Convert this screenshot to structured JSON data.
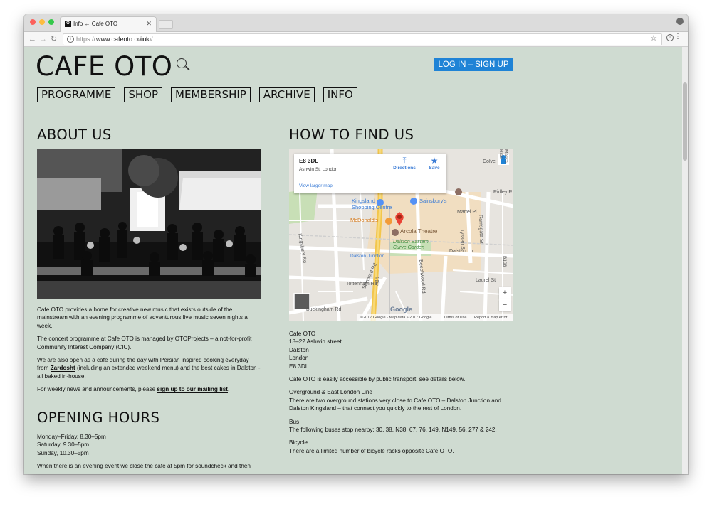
{
  "browser": {
    "tab_title": "Info ← Cafe OTO",
    "url_prefix": "https://",
    "url_host": "www.cafeoto.co.uk",
    "url_path": "/info/"
  },
  "site": {
    "logo": "CAFE OTO",
    "login_label": "LOG IN – SIGN UP",
    "nav": [
      "PROGRAMME",
      "SHOP",
      "MEMBERSHIP",
      "ARCHIVE",
      "INFO"
    ]
  },
  "about": {
    "heading": "ABOUT US",
    "p1": "Cafe OTO provides a home for creative new music that exists outside of the mainstream with an evening programme of adventurous live music seven nights a week.",
    "p2": "The concert programme at Cafe OTO is managed by OTOProjects – a not-for-profit Community Interest Company (CIC).",
    "p3_a": "We are also open as a cafe during the day with Persian inspired cooking everyday from ",
    "p3_link": "Zardosht",
    "p3_b": " (including an extended weekend menu) and the best cakes in Dalston - all baked in-house.",
    "p4_a": "For weekly news and announcements, please ",
    "p4_link": "sign up to our mailing list",
    "p4_b": "."
  },
  "hours": {
    "heading": "OPENING HOURS",
    "lines": [
      "Monday–Friday, 8.30–5pm",
      "Saturday, 9.30–5pm",
      "Sunday, 10.30–5pm"
    ],
    "note": "When there is an evening event we close the cafe at 5pm for soundcheck and then"
  },
  "find": {
    "heading": "HOW TO FIND US",
    "map": {
      "place_title": "E8 3DL",
      "place_address": "Ashwin St, London",
      "directions": "Directions",
      "save": "Save",
      "larger_map": "View larger map",
      "labels": {
        "kingsland": "Kingsland",
        "shopping_centre": "Shopping Centre",
        "sainsburys": "Sainsbury's",
        "mcdonalds": "McDonald's",
        "arcola": "Arcola Theatre",
        "dalston_eastern": "Dalston Eastern",
        "curve_garden": "Curve Garden",
        "dalston_junction": "Dalston Junction",
        "dalston_ln": "Dalston Ln",
        "kingsbury_rd": "Kingsbury Rd",
        "tottenham_rd": "Tottenham Rd",
        "buckingham_rd": "Buckingham Rd",
        "stamford_rd": "Stamford Rd",
        "a10": "A10",
        "beechwood_rd": "Beechwood Rd",
        "tyssen_st": "Tyssen St",
        "ramsgate_st": "Ramsgate St",
        "martel_pl": "Martel Pl",
        "ridley_r": "Ridley R",
        "colve": "Colve",
        "marks_rise": "Mark's Rise",
        "laurel_st": "Laurel St",
        "b108": "B108",
        "google": "Google",
        "data": "©2017 Google - Map data ©2017 Google",
        "terms": "Terms of Use",
        "report": "Report a map error"
      }
    },
    "address_lines": [
      "Cafe OTO",
      "18–22 Ashwin street",
      "Dalston",
      "London",
      "E8 3DL"
    ],
    "access": "Cafe OTO is easily accessible by public transport, see details below.",
    "overground_title": "Overground & East London Line",
    "overground_text": "There are two overground stations very close to Cafe OTO – Dalston Junction and Dalston Kingsland – that connect you quickly to the rest of London.",
    "bus_title": "Bus",
    "bus_text": "The following buses stop nearby: 30, 38, N38, 67, 76, 149, N149, 56, 277 & 242.",
    "bicycle_title": "Bicycle",
    "bicycle_text": "There are a limited number of bicycle racks opposite Cafe OTO."
  },
  "colors": {
    "page_bg": "#cfdbd1",
    "login_bg": "#1f83d6"
  }
}
